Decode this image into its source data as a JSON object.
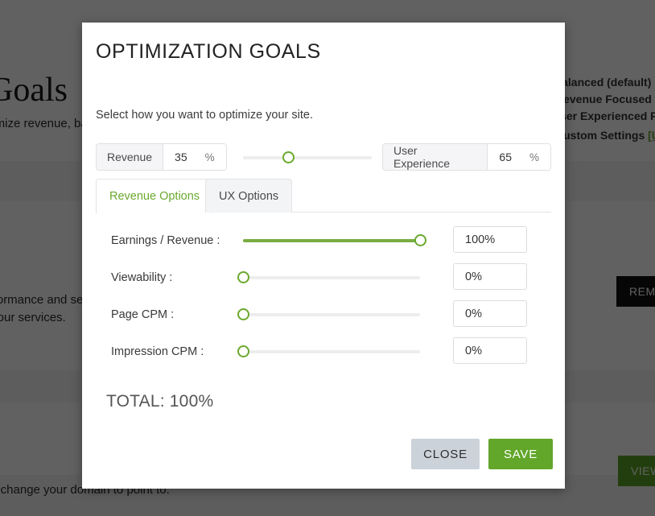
{
  "background": {
    "heading": "Goals",
    "subtitle": "Maximize revenue, balance UX",
    "paragraph_line1": "performance and security",
    "paragraph_line2": "of our services.",
    "footnote": "to change your domain to point to.",
    "preset_options": [
      "Balanced (default)",
      "Revenue Focused",
      "User Experienced Focused",
      "Custom Settings"
    ],
    "custom_settings_link": "[Update]",
    "remove_button": "REMOVE",
    "view_button": "VIEW"
  },
  "modal": {
    "title": "OPTIMIZATION GOALS",
    "subtitle": "Select how you want to optimize your site.",
    "split": {
      "revenue": {
        "label": "Revenue",
        "value": "35",
        "unit": "%"
      },
      "user_experience": {
        "label": "User Experience",
        "value": "65",
        "unit": "%"
      },
      "slider_position_percent": 35
    },
    "tabs": [
      {
        "label": "Revenue Options",
        "active": true
      },
      {
        "label": "UX Options",
        "active": false
      }
    ],
    "options": [
      {
        "label": "Earnings / Revenue :",
        "value": "100%",
        "percent": 100
      },
      {
        "label": "Viewability :",
        "value": "0%",
        "percent": 0
      },
      {
        "label": "Page CPM :",
        "value": "0%",
        "percent": 0
      },
      {
        "label": "Impression CPM :",
        "value": "0%",
        "percent": 0
      }
    ],
    "total": "TOTAL: 100%",
    "footer": {
      "close_label": "CLOSE",
      "save_label": "SAVE"
    }
  },
  "colors": {
    "accent_green": "#6aa92e",
    "slider_fill": "#79ac40",
    "save_green": "#62a62a",
    "close_gray": "#ccd2da",
    "track_gray": "#ededed"
  }
}
